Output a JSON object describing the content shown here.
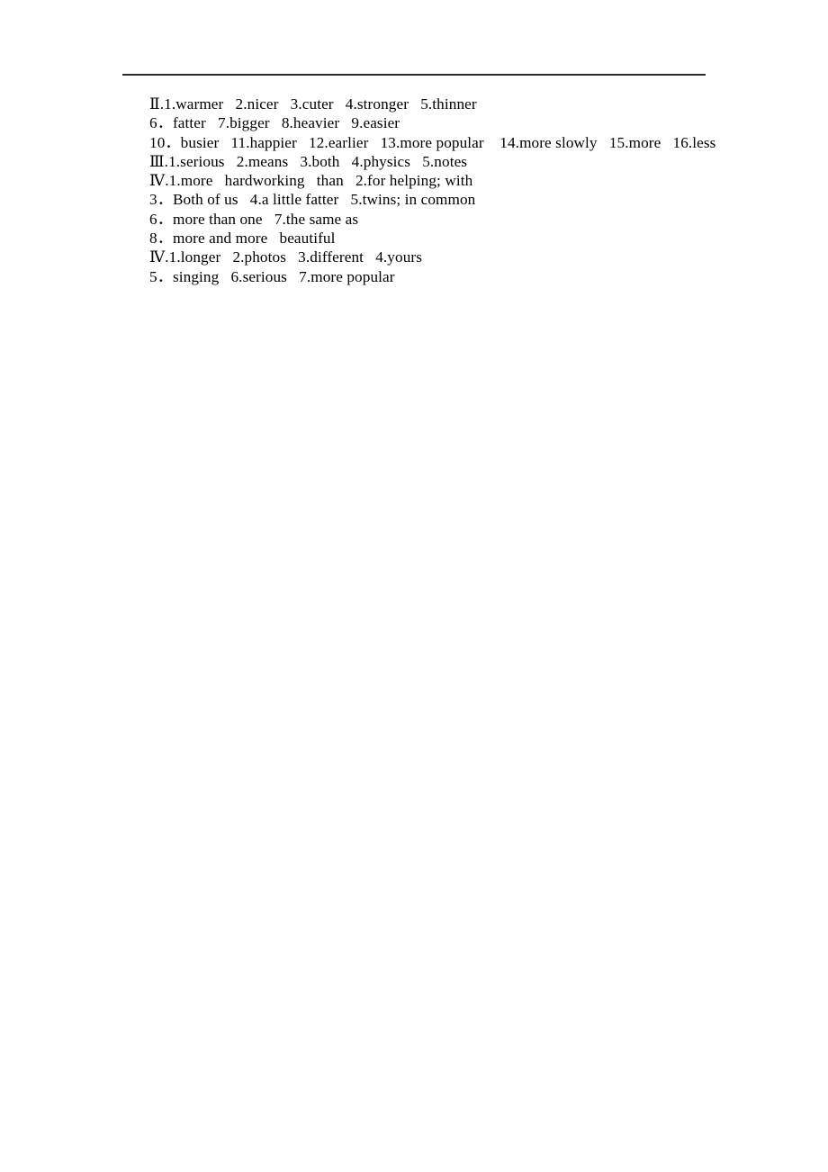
{
  "document": {
    "type": "answer-key",
    "has_header_rule": true,
    "text_color": "#000000",
    "background_color": "#ffffff",
    "lines": [
      {
        "id": "line-1",
        "text": "Ⅱ.1.warmer   2.nicer   3.cuter   4.stronger   5.thinner"
      },
      {
        "id": "line-2",
        "text": "6．fatter   7.bigger   8.heavier   9.easier"
      },
      {
        "id": "line-3",
        "text": "10．busier   11.happier   12.earlier   13.more popular    14.more slowly   15.more   16.less"
      },
      {
        "id": "line-4",
        "text": "Ⅲ.1.serious   2.means   3.both   4.physics   5.notes"
      },
      {
        "id": "line-5",
        "text": "Ⅳ.1.more   hardworking   than   2.for helping; with"
      },
      {
        "id": "line-6",
        "text": "3．Both of us   4.a little fatter   5.twins; in common"
      },
      {
        "id": "line-7",
        "text": "6．more than one   7.the same as"
      },
      {
        "id": "line-8",
        "text": "8．more and more   beautiful"
      },
      {
        "id": "line-9",
        "text": "Ⅳ.1.longer   2.photos   3.different   4.yours"
      },
      {
        "id": "line-10",
        "text": "5．singing   6.serious   7.more popular"
      }
    ]
  }
}
